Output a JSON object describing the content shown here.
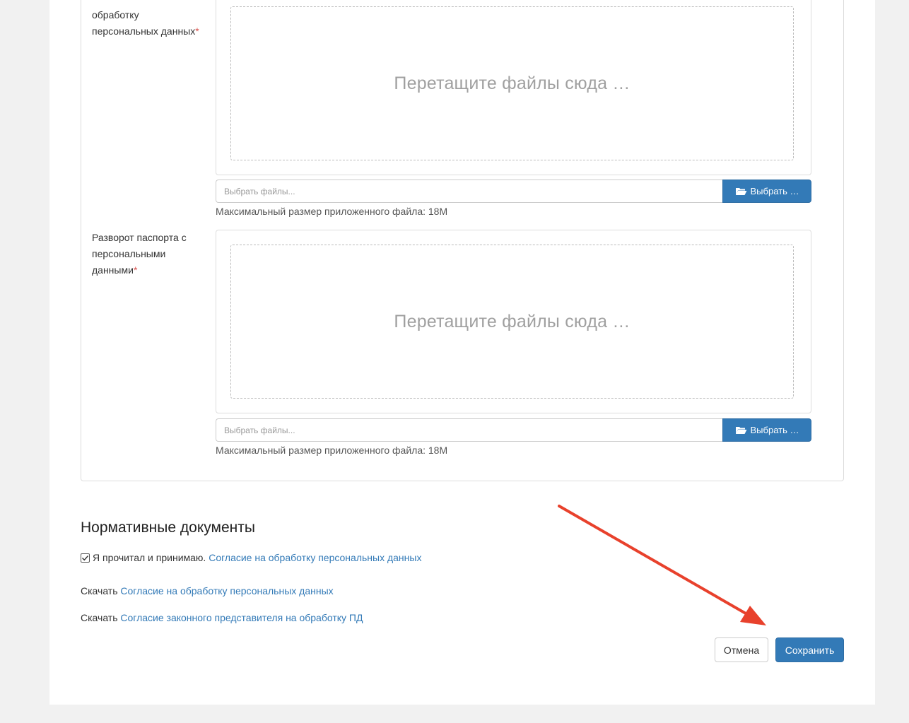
{
  "upload_fields": [
    {
      "label": "обработку персональных данных",
      "required_mark": "*",
      "drop_text": "Перетащите файлы сюда …",
      "file_placeholder": "Выбрать файлы...",
      "browse_label": "Выбрать …",
      "max_size_hint": "Максимальный размер приложенного файла: 18M"
    },
    {
      "label": "Разворот паспорта с персональными данными",
      "required_mark": "*",
      "drop_text": "Перетащите файлы сюда …",
      "file_placeholder": "Выбрать файлы...",
      "browse_label": "Выбрать …",
      "max_size_hint": "Максимальный размер приложенного файла: 18M"
    }
  ],
  "normative": {
    "title": "Нормативные документы",
    "agree_text": "Я прочитал и принимаю.",
    "agree_checked": true,
    "agree_link": "Согласие на обработку персональных данных",
    "downloads": [
      {
        "prefix": "Скачать",
        "link": "Согласие на обработку персональных данных"
      },
      {
        "prefix": "Скачать",
        "link": "Согласие законного представителя на обработку ПД"
      }
    ]
  },
  "actions": {
    "cancel_label": "Отмена",
    "save_label": "Сохранить"
  },
  "colors": {
    "primary": "#337ab7",
    "required": "#d9534f",
    "annotation_arrow": "#e8412c"
  },
  "icons": {
    "browse": "folder-open-icon",
    "checkbox": "check-icon",
    "annotation": "arrow-icon"
  }
}
